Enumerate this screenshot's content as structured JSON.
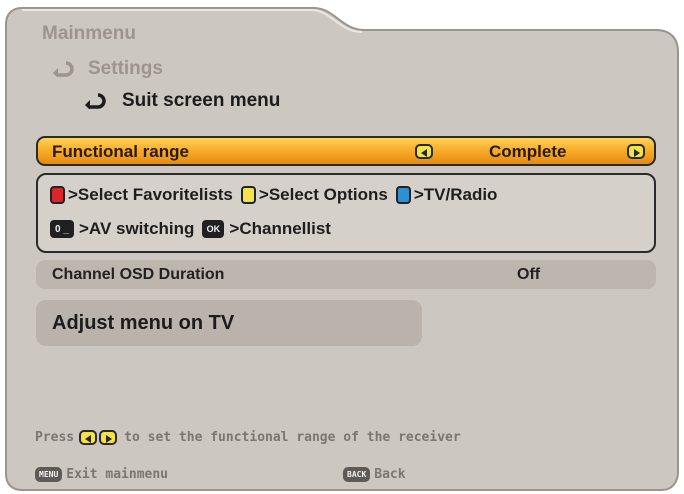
{
  "breadcrumb": {
    "level1": "Mainmenu",
    "level2": "Settings",
    "level3": "Suit screen menu"
  },
  "functional_range": {
    "label": "Functional range",
    "value": "Complete"
  },
  "keys": {
    "red": ">Select Favoritelists",
    "yellow": ">Select Options",
    "blue": ">TV/Radio",
    "zero": ">AV switching",
    "ok_key": "OK",
    "ok": ">Channellist",
    "zero_key": "0 _"
  },
  "osd": {
    "label": "Channel OSD Duration",
    "value": "Off"
  },
  "adjust": {
    "label": "Adjust menu on TV"
  },
  "hint": {
    "press": "Press",
    "text": "to set the functional range of the receiver"
  },
  "footer": {
    "menu_key": "MENU",
    "exit": "Exit mainmenu",
    "back_key": "BACK",
    "back": "Back"
  },
  "colors": {
    "highlight": "#f9ae2c",
    "red_key": "#d8262a",
    "yellow_key": "#f4e24a",
    "blue_key": "#2f8fd1",
    "panel": "#cdc7c2"
  }
}
